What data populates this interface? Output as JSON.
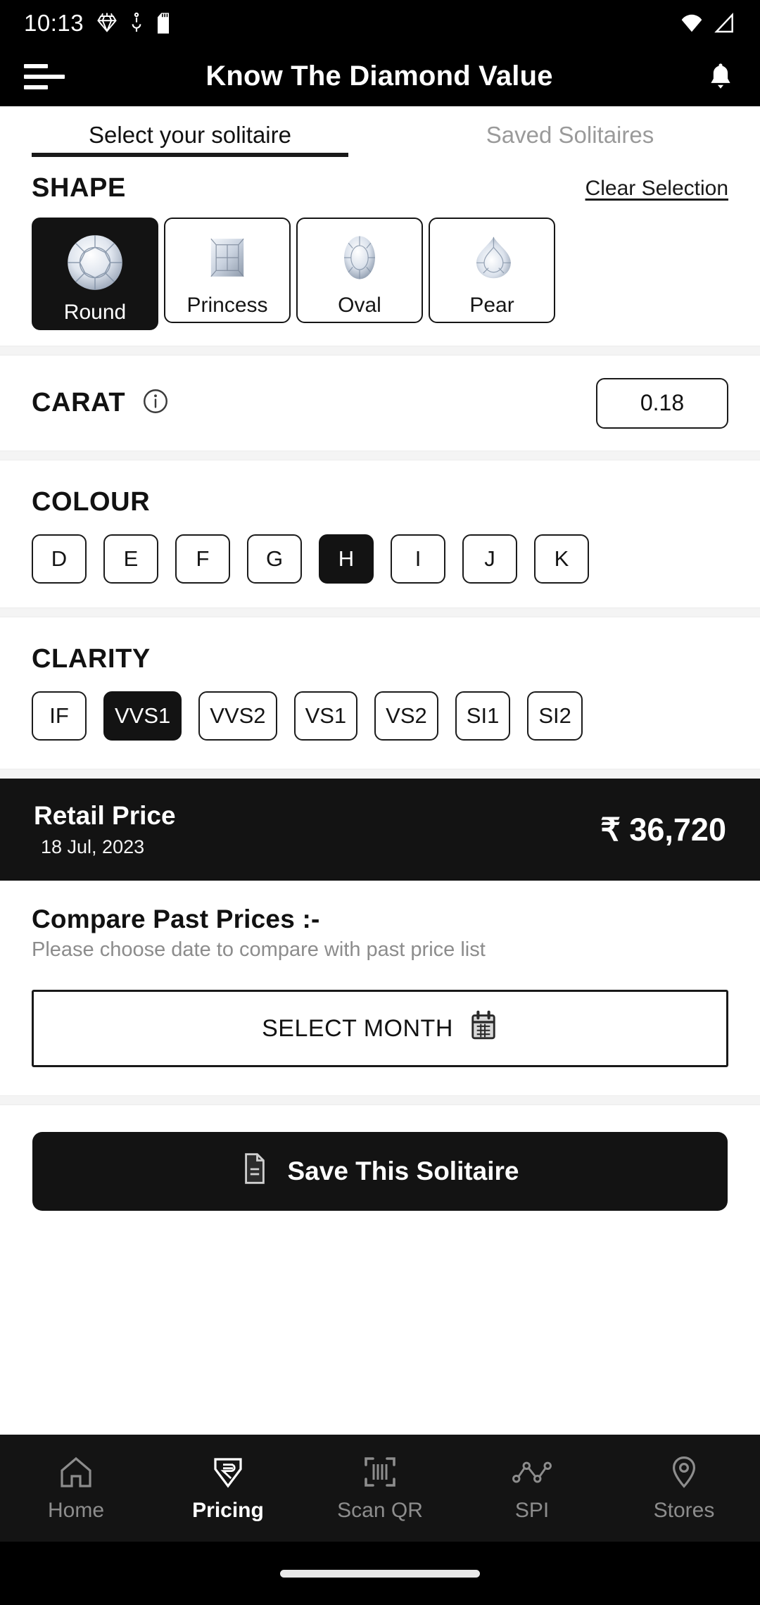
{
  "status_bar": {
    "time": "10:13",
    "left_icons": [
      "diamond-icon",
      "location-icon",
      "sd-card-icon"
    ],
    "right_icons": [
      "wifi-icon",
      "signal-icon"
    ]
  },
  "app_bar": {
    "menu_icon": "hamburger-menu-icon",
    "title": "Know The Diamond Value",
    "notification_icon": "bell-icon"
  },
  "tabs": [
    {
      "label": "Select your solitaire",
      "active": true
    },
    {
      "label": "Saved Solitaires",
      "active": false
    }
  ],
  "shape": {
    "title": "SHAPE",
    "clear_label": "Clear Selection",
    "options": [
      {
        "label": "Round",
        "selected": true
      },
      {
        "label": "Princess",
        "selected": false
      },
      {
        "label": "Oval",
        "selected": false
      },
      {
        "label": "Pear",
        "selected": false
      }
    ]
  },
  "carat": {
    "title": "CARAT",
    "info_icon": "info-icon",
    "value": "0.18",
    "placeholder": "0.18"
  },
  "colour": {
    "title": "COLOUR",
    "options": [
      {
        "label": "D",
        "selected": false
      },
      {
        "label": "E",
        "selected": false
      },
      {
        "label": "F",
        "selected": false
      },
      {
        "label": "G",
        "selected": false
      },
      {
        "label": "H",
        "selected": true
      },
      {
        "label": "I",
        "selected": false
      },
      {
        "label": "J",
        "selected": false
      },
      {
        "label": "K",
        "selected": false
      }
    ]
  },
  "clarity": {
    "title": "CLARITY",
    "options": [
      {
        "label": "IF",
        "selected": false
      },
      {
        "label": "VVS1",
        "selected": true
      },
      {
        "label": "VVS2",
        "selected": false
      },
      {
        "label": "VS1",
        "selected": false
      },
      {
        "label": "VS2",
        "selected": false
      },
      {
        "label": "SI1",
        "selected": false
      },
      {
        "label": "SI2",
        "selected": false
      }
    ]
  },
  "retail_price": {
    "label": "Retail Price",
    "date": "18 Jul, 2023",
    "value": "₹ 36,720"
  },
  "compare": {
    "title": "Compare Past Prices :-",
    "subtitle": "Please choose date to compare with past price list",
    "button_label": "SELECT MONTH",
    "button_icon": "calendar-icon"
  },
  "save": {
    "label": "Save This Solitaire",
    "icon": "document-icon"
  },
  "bottom_nav": [
    {
      "label": "Home",
      "icon": "home-icon",
      "active": false
    },
    {
      "label": "Pricing",
      "icon": "diamond-rupee-icon",
      "active": true
    },
    {
      "label": "Scan QR",
      "icon": "qr-scan-icon",
      "active": false
    },
    {
      "label": "SPI",
      "icon": "line-chart-icon",
      "active": false
    },
    {
      "label": "Stores",
      "icon": "location-pin-icon",
      "active": false
    }
  ],
  "colors": {
    "primary_dark": "#131313",
    "surface": "#ffffff",
    "muted_text": "#8c8c8c",
    "separator": "#f4f4f4",
    "nav_bar": "#141414"
  }
}
